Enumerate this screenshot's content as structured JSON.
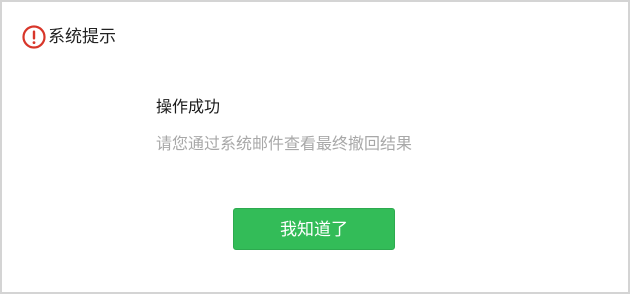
{
  "dialog": {
    "title": "系统提示",
    "title_icon": "exclamation-circle-icon",
    "message": "操作成功",
    "sub_message": "请您通过系统邮件查看最终撤回结果",
    "confirm_label": "我知道了"
  },
  "colors": {
    "icon_red": "#d8362a",
    "button_green": "#33bc58",
    "sub_text_gray": "#a8a8a8"
  }
}
